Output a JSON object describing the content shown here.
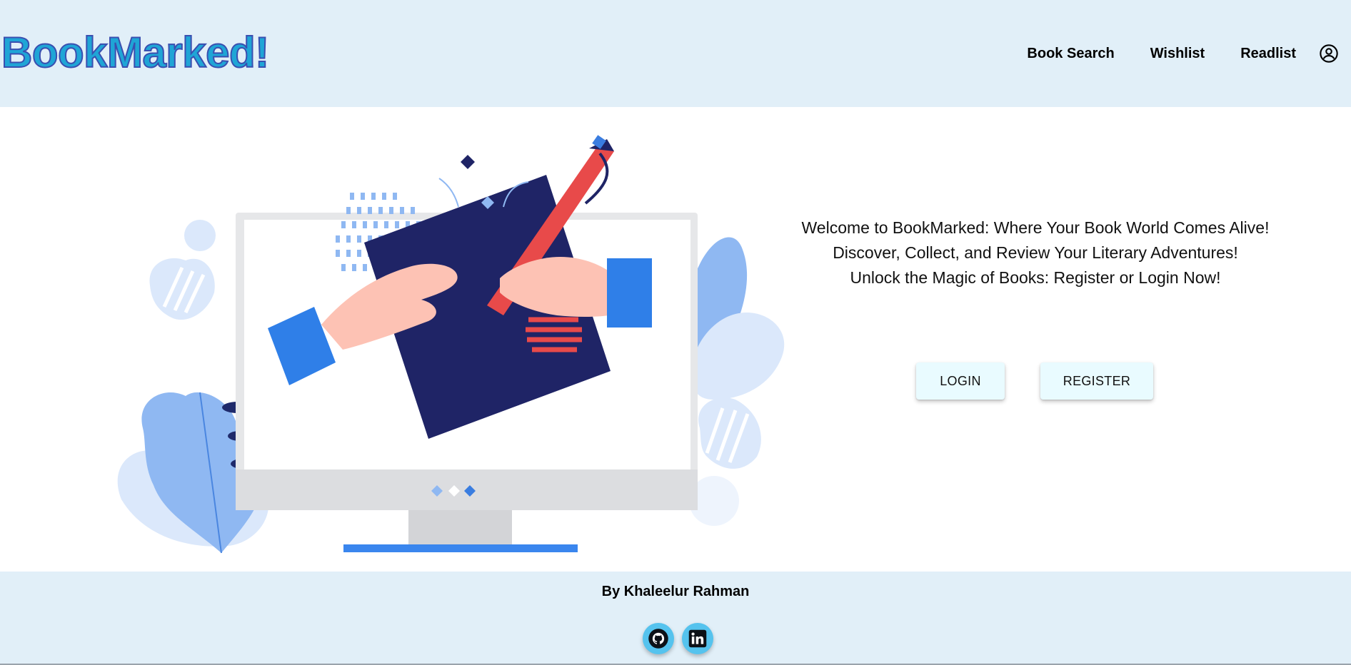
{
  "header": {
    "logo": "BookMarked!",
    "nav": [
      {
        "label": "Book Search"
      },
      {
        "label": "Wishlist"
      },
      {
        "label": "Readlist"
      }
    ],
    "account_icon": "account-circle-icon"
  },
  "main": {
    "illustration": "person-writing-on-monitor-illustration",
    "welcome_lines": [
      "Welcome to BookMarked: Where Your Book World Comes Alive!",
      "Discover, Collect, and Review Your Literary Adventures!",
      "Unlock the Magic of Books: Register or Login Now!"
    ],
    "login_label": "LOGIN",
    "register_label": "REGISTER"
  },
  "footer": {
    "author": "By Khaleelur Rahman",
    "social": [
      {
        "icon": "github-icon"
      },
      {
        "icon": "linkedin-icon"
      }
    ]
  },
  "colors": {
    "header_bg": "#e1eff8",
    "logo_fill": "#1fa5d6",
    "logo_stroke": "#3a4fb0",
    "button_bg": "#e9fbff",
    "social_bg": "#55c3ee"
  }
}
